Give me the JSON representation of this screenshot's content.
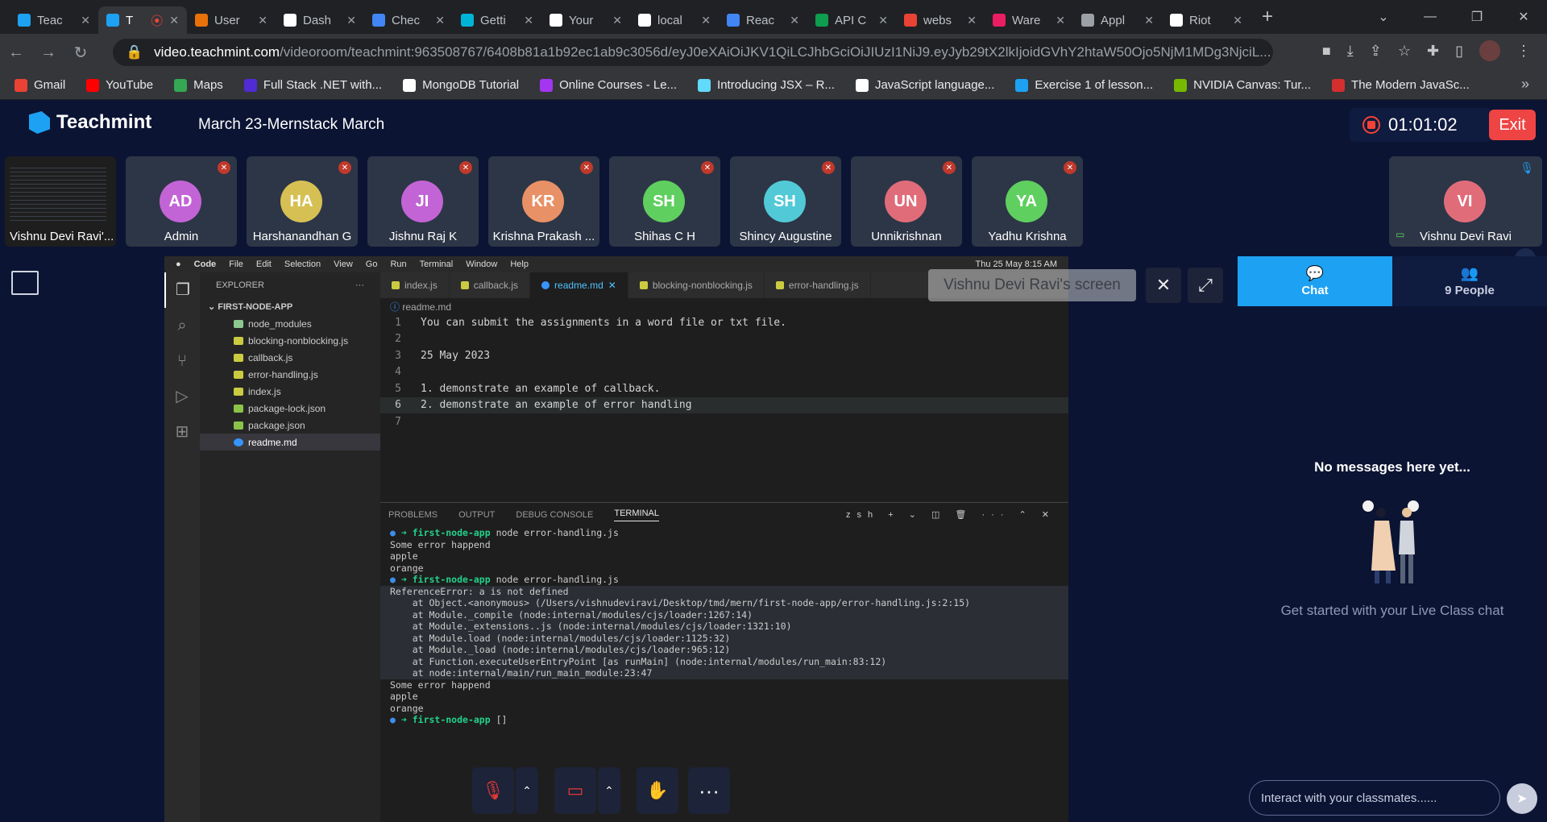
{
  "browser": {
    "tabs": [
      {
        "label": "Teac",
        "color": "#1da1f2"
      },
      {
        "label": "T",
        "color": "#1da1f2",
        "active": true
      },
      {
        "label": "User",
        "color": "#e8710a"
      },
      {
        "label": "Dash",
        "color": "#ffffff"
      },
      {
        "label": "Chec",
        "color": "#4285f4"
      },
      {
        "label": "Getti",
        "color": "#00b4d8"
      },
      {
        "label": "Your",
        "color": "#ffffff"
      },
      {
        "label": "local",
        "color": "#ffffff"
      },
      {
        "label": "Reac",
        "color": "#4285f4"
      },
      {
        "label": "API C",
        "color": "#0d9e4f"
      },
      {
        "label": "webs",
        "color": "#ea4335"
      },
      {
        "label": "Ware",
        "color": "#e91e63"
      },
      {
        "label": "Appl",
        "color": "#9aa0a6"
      },
      {
        "label": "Riot",
        "color": "#ffffff"
      }
    ],
    "url_host": "video.teachmint.com",
    "url_path": "/videoroom/teachmint:963508767/6408b81a1b92ec1ab9c3056d/eyJ0eXAiOiJKV1QiLCJhbGciOiJIUzI1NiJ9.eyJyb29tX2lkIjoidGVhY2htaW50Ojo5NjM1MDg3NjciL...",
    "bookmarks": [
      {
        "label": "Gmail",
        "color": "#ea4335"
      },
      {
        "label": "YouTube",
        "color": "#ff0000"
      },
      {
        "label": "Maps",
        "color": "#34a853"
      },
      {
        "label": "Full Stack .NET with...",
        "color": "#512bd4"
      },
      {
        "label": "MongoDB Tutorial",
        "color": "#ffffff"
      },
      {
        "label": "Online Courses - Le...",
        "color": "#a435f0"
      },
      {
        "label": "Introducing JSX – R...",
        "color": "#61dafb"
      },
      {
        "label": "JavaScript language...",
        "color": "#ffffff"
      },
      {
        "label": "Exercise 1 of lesson...",
        "color": "#1da1f2"
      },
      {
        "label": "NVIDIA Canvas: Tur...",
        "color": "#76b900"
      },
      {
        "label": "The Modern JavaSc...",
        "color": "#d32f2f"
      }
    ]
  },
  "app": {
    "brand": "Teachmint",
    "class_name": "March 23-Mernstack March",
    "timer": "01:01:02",
    "exit_label": "Exit"
  },
  "participants": {
    "screen_share_name": "Vishnu Devi Ravi'...",
    "list": [
      {
        "initials": "AD",
        "name": "Admin",
        "color": "#c264d6"
      },
      {
        "initials": "HA",
        "name": "Harshanandhan G",
        "color": "#d6c054"
      },
      {
        "initials": "JI",
        "name": "Jishnu Raj K",
        "color": "#c264d6"
      },
      {
        "initials": "KR",
        "name": "Krishna Prakash ...",
        "color": "#e89066"
      },
      {
        "initials": "SH",
        "name": "Shihas C H",
        "color": "#5fcf5f"
      },
      {
        "initials": "SH",
        "name": "Shincy Augustine",
        "color": "#52c9d6"
      },
      {
        "initials": "UN",
        "name": "Unnikrishnan",
        "color": "#e06c7a"
      },
      {
        "initials": "YA",
        "name": "Yadhu Krishna",
        "color": "#5fcf5f"
      }
    ],
    "self": {
      "initials": "VI",
      "name": "Vishnu Devi Ravi",
      "color": "#e06c7a"
    }
  },
  "screen": {
    "badge": "Vishnu Devi Ravi's screen",
    "mac_menu": [
      "Code",
      "File",
      "Edit",
      "Selection",
      "View",
      "Go",
      "Run",
      "Terminal",
      "Window",
      "Help"
    ],
    "mac_clock": "Thu 25 May  8:15 AM",
    "explorer_title": "EXPLORER",
    "project": "FIRST-NODE-APP",
    "files": [
      {
        "name": "node_modules",
        "type": "dir"
      },
      {
        "name": "blocking-nonblocking.js",
        "type": "js"
      },
      {
        "name": "callback.js",
        "type": "js"
      },
      {
        "name": "error-handling.js",
        "type": "js"
      },
      {
        "name": "index.js",
        "type": "js"
      },
      {
        "name": "package-lock.json",
        "type": "json"
      },
      {
        "name": "package.json",
        "type": "json"
      },
      {
        "name": "readme.md",
        "type": "md",
        "selected": true
      }
    ],
    "editor_tabs": [
      "index.js",
      "callback.js",
      "readme.md",
      "blocking-nonblocking.js",
      "error-handling.js"
    ],
    "breadcrumb": "readme.md",
    "code_lines": [
      "You can submit the assignments in a word file or txt file.",
      "",
      "25 May 2023",
      "",
      "1. demonstrate an example of callback.",
      "2. demonstrate an example of error handling",
      ""
    ],
    "terminal_tabs": [
      "PROBLEMS",
      "OUTPUT",
      "DEBUG CONSOLE",
      "TERMINAL"
    ],
    "terminal_shell": "zsh",
    "terminal_lines": [
      {
        "prompt": "first-node-app",
        "text": " node error-handling.js"
      },
      {
        "text": "Some error happend"
      },
      {
        "text": "apple"
      },
      {
        "text": "orange"
      },
      {
        "prompt": "first-node-app",
        "text": " node error-handling.js"
      },
      {
        "text": "ReferenceError: a is not defined",
        "err": true
      },
      {
        "text": "    at Object.<anonymous> (/Users/vishnudeviravi/Desktop/tmd/mern/first-node-app/error-handling.js:2:15)",
        "err": true
      },
      {
        "text": "    at Module._compile (node:internal/modules/cjs/loader:1267:14)",
        "err": true
      },
      {
        "text": "    at Module._extensions..js (node:internal/modules/cjs/loader:1321:10)",
        "err": true
      },
      {
        "text": "    at Module.load (node:internal/modules/cjs/loader:1125:32)",
        "err": true
      },
      {
        "text": "    at Module._load (node:internal/modules/cjs/loader:965:12)",
        "err": true
      },
      {
        "text": "    at Function.executeUserEntryPoint [as runMain] (node:internal/modules/run_main:83:12)",
        "err": true
      },
      {
        "text": "    at node:internal/main/run_main_module:23:47",
        "err": true
      },
      {
        "text": "Some error happend"
      },
      {
        "text": "apple"
      },
      {
        "text": "orange"
      },
      {
        "prompt": "first-node-app",
        "text": " []"
      }
    ]
  },
  "side_panel": {
    "chat_tab": "Chat",
    "people_tab": "9 People",
    "empty_title": "No messages here yet...",
    "empty_sub": "Get started with your Live Class chat",
    "input_placeholder": "Interact with your classmates......"
  }
}
